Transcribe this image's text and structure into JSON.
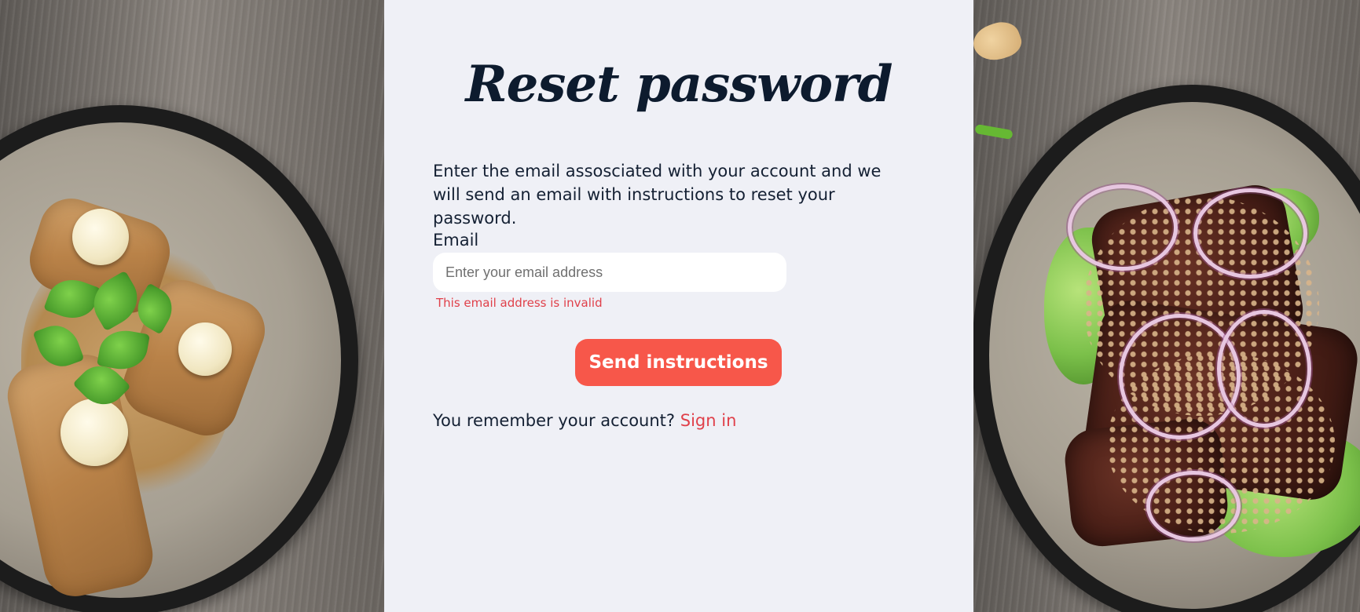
{
  "page": {
    "title": "Reset password",
    "description": "Enter the email assosciated with your account and we will send an email with instructions to reset your password."
  },
  "form": {
    "email_label": "Email",
    "email_placeholder": "Enter your email address",
    "email_value": "",
    "error_message": "This email address is invalid",
    "submit_label": "Send instructions"
  },
  "footer": {
    "prompt": "You remember your account?",
    "signin_label": "Sign in"
  },
  "colors": {
    "panel_background": "#eff0f6",
    "title_text": "#0d1b2e",
    "accent_button": "#f7574a",
    "error_link": "#e0404a"
  }
}
